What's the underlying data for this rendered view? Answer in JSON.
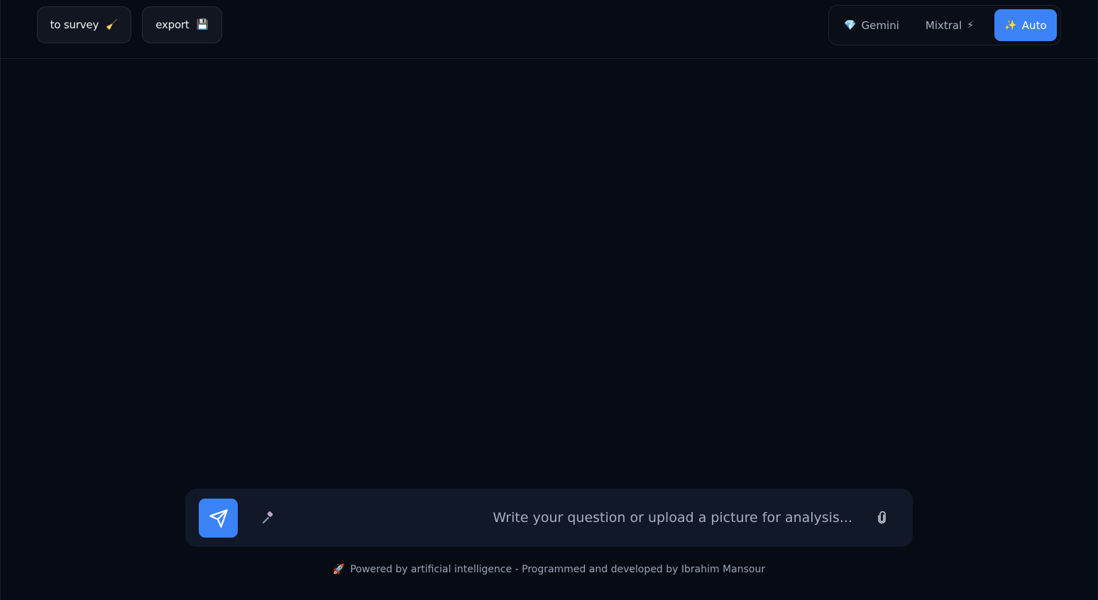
{
  "header": {
    "buttons": {
      "survey": {
        "label": "to survey",
        "icon": "broom-icon",
        "icon_glyph": "🧹"
      },
      "export": {
        "label": "export",
        "icon": "floppy-disk-icon",
        "icon_glyph": "💾"
      }
    },
    "model_selector": {
      "selected": "Auto",
      "options": [
        {
          "label": "Gemini",
          "icon": "gem-icon",
          "icon_glyph": "💎"
        },
        {
          "label": "Mixtral",
          "icon": "lightning-icon",
          "icon_glyph": "⚡"
        },
        {
          "label": "Auto",
          "icon": "sparkles-icon",
          "icon_glyph": "✨"
        }
      ]
    }
  },
  "composer": {
    "placeholder": "...Write your question or upload a picture for analysis",
    "value": "",
    "send_icon": "send-icon",
    "mic_icon": "microphone-icon",
    "attach_icon": "paperclip-icon"
  },
  "footer": {
    "icon": "rocket-icon",
    "icon_glyph": "🚀",
    "text": "Powered by artificial intelligence - Programmed and developed by Ibrahim Mansour"
  },
  "colors": {
    "background": "#070b14",
    "accent": "#3b82f6",
    "composer_bg": "#111828"
  }
}
